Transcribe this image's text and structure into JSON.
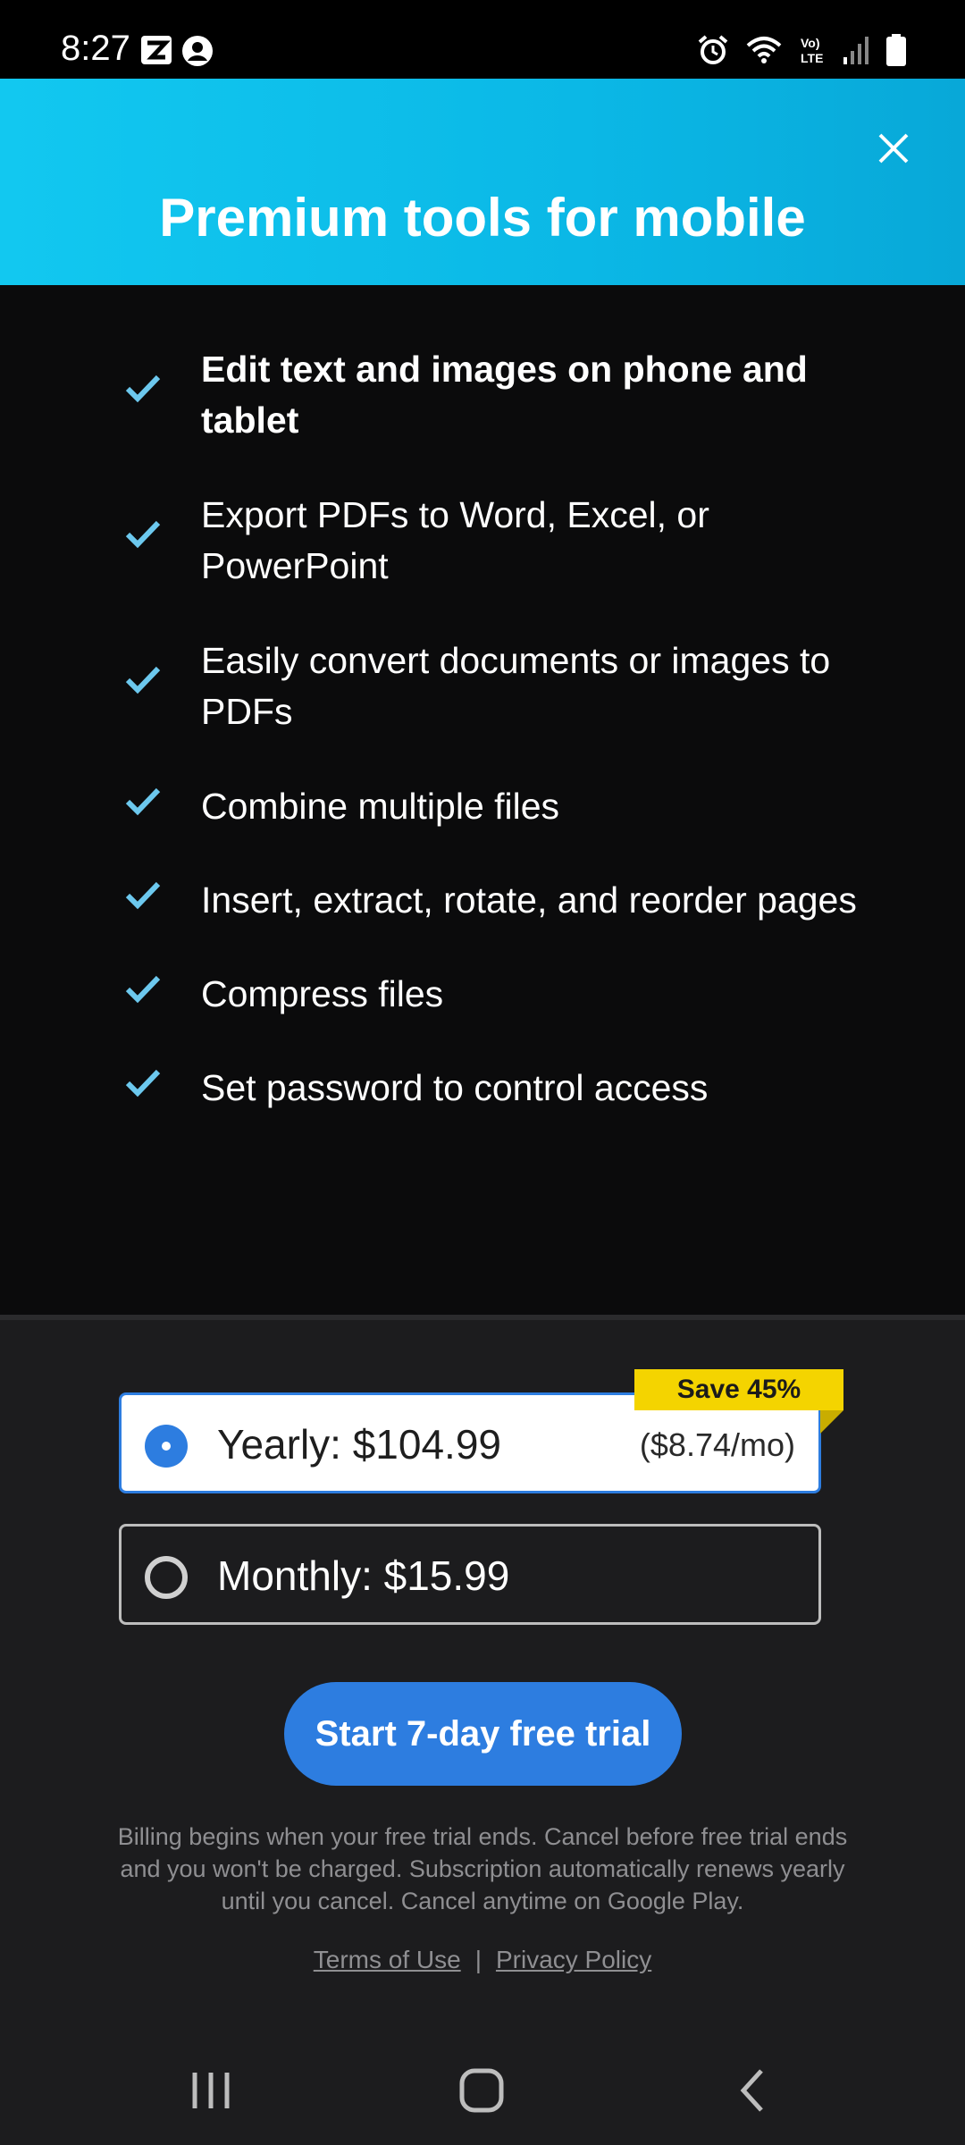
{
  "status_bar": {
    "time": "8:27",
    "left_icons": [
      "z-app-icon",
      "account-circle-icon"
    ],
    "right_icons": [
      "alarm-icon",
      "wifi-icon",
      "volte-icon",
      "signal-icon",
      "battery-icon"
    ]
  },
  "header": {
    "title": "Premium tools for mobile",
    "close_icon": "close-icon",
    "gradient_colors": [
      "#12c8f0",
      "#08a8d8"
    ]
  },
  "features": [
    {
      "text": "Edit text and images on phone and tablet",
      "bold": true
    },
    {
      "text": "Export PDFs to Word, Excel, or PowerPoint",
      "bold": false
    },
    {
      "text": "Easily convert documents or images to PDFs",
      "bold": false
    },
    {
      "text": "Combine multiple files",
      "bold": false
    },
    {
      "text": "Insert, extract, rotate, and reorder pages",
      "bold": false
    },
    {
      "text": "Compress files",
      "bold": false
    },
    {
      "text": "Set password to control access",
      "bold": false
    }
  ],
  "check_color": "#6cc8ee",
  "plans": {
    "selected": "yearly",
    "yearly": {
      "label": "Yearly: $104.99",
      "per_month": "($8.74/mo)",
      "badge": "Save 45%"
    },
    "monthly": {
      "label": "Monthly: $15.99"
    }
  },
  "cta": {
    "label": "Start 7-day free trial",
    "color": "#2d7de0"
  },
  "legal": {
    "text": "Billing begins when your free trial ends. Cancel before free trial ends and you won't be charged. Subscription automatically renews yearly until you cancel. Cancel anytime on Google Play.",
    "terms": "Terms of Use",
    "separator": "|",
    "privacy": "Privacy Policy"
  },
  "nav_bar": {
    "icons": [
      "recent-apps-icon",
      "home-icon",
      "back-icon"
    ]
  }
}
